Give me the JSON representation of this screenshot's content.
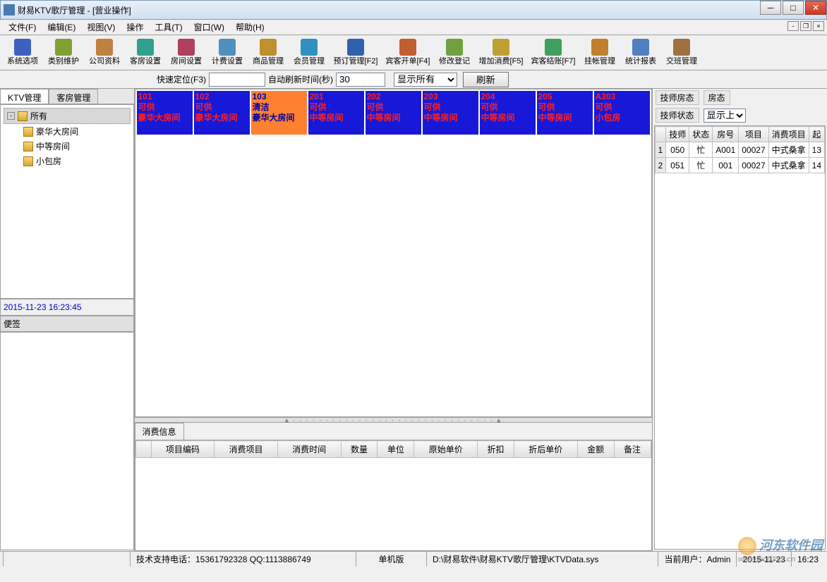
{
  "title": "财易KTV歌厅管理 - [营业操作]",
  "menus": [
    "文件(F)",
    "编辑(E)",
    "视图(V)",
    "操作",
    "工具(T)",
    "窗口(W)",
    "帮助(H)"
  ],
  "toolbar": [
    {
      "label": "系统选项",
      "c": "#4060c0"
    },
    {
      "label": "类别维护",
      "c": "#80a030"
    },
    {
      "label": "公司资料",
      "c": "#c08040"
    },
    {
      "label": "客房设置",
      "c": "#30a090"
    },
    {
      "label": "房间设置",
      "c": "#b04060"
    },
    {
      "label": "计费设置",
      "c": "#5090c0"
    },
    {
      "label": "商品管理",
      "c": "#c09030"
    },
    {
      "label": "会员管理",
      "c": "#3090c0"
    },
    {
      "label": "预订管理[F2]",
      "c": "#3060b0",
      "wide": true
    },
    {
      "label": "宾客开单[F4]",
      "c": "#c06030",
      "wide": true
    },
    {
      "label": "修改登记",
      "c": "#70a040"
    },
    {
      "label": "增加消费[F5]",
      "c": "#c0a030",
      "wide": true
    },
    {
      "label": "宾客结账[F7]",
      "c": "#40a060",
      "wide": true
    },
    {
      "label": "挂帐管理",
      "c": "#c08030"
    },
    {
      "label": "统计报表",
      "c": "#5080c0"
    },
    {
      "label": "交班管理",
      "c": "#a07040"
    }
  ],
  "filter": {
    "locate_label": "快速定位(F3)",
    "locate_val": "",
    "refresh_label": "自动刷新时间(秒)",
    "refresh_val": "30",
    "show_label": "显示所有",
    "show_val": "显示所有",
    "refresh_btn": "刷新"
  },
  "left_tabs": [
    "KTV管理",
    "客房管理"
  ],
  "tree": {
    "root": "所有",
    "children": [
      "豪华大房间",
      "中等房间",
      "小包房"
    ]
  },
  "timestamp": "2015-11-23 16:23:45",
  "notes_label": "便签",
  "rooms": [
    {
      "no": "101",
      "status": "可供",
      "type": "豪华大房间",
      "cls": "blue"
    },
    {
      "no": "102",
      "status": "可供",
      "type": "豪华大房间",
      "cls": "blue"
    },
    {
      "no": "103",
      "status": "清洁",
      "type": "豪华大房间",
      "cls": "orange"
    },
    {
      "no": "201",
      "status": "可供",
      "type": "中等房间",
      "cls": "blue"
    },
    {
      "no": "202",
      "status": "可供",
      "type": "中等房间",
      "cls": "blue"
    },
    {
      "no": "203",
      "status": "可供",
      "type": "中等房间",
      "cls": "blue"
    },
    {
      "no": "204",
      "status": "可供",
      "type": "中等房间",
      "cls": "blue"
    },
    {
      "no": "205",
      "status": "可供",
      "type": "中等房间",
      "cls": "blue"
    },
    {
      "no": "A303",
      "status": "可供",
      "type": "小包房",
      "cls": "blue"
    }
  ],
  "cons_tab": "消费信息",
  "cons_cols": [
    "项目编码",
    "消费项目",
    "消费时间",
    "数量",
    "单位",
    "原始单价",
    "折扣",
    "折后单价",
    "金额",
    "备注"
  ],
  "right": {
    "tech_room": "技师房态",
    "room_state": "房态",
    "tech_state": "技师状态",
    "show_sel": "显示上",
    "cols": [
      "技师",
      "状态",
      "房号",
      "项目",
      "消费项目",
      "起"
    ],
    "rows": [
      {
        "i": "1",
        "tech": "050",
        "st": "忙",
        "room": "A001",
        "proj": "00027",
        "item": "中式桑拿",
        "start": "13"
      },
      {
        "i": "2",
        "tech": "051",
        "st": "忙",
        "room": "001",
        "proj": "00027",
        "item": "中式桑拿",
        "start": "14"
      }
    ]
  },
  "status": {
    "empty": "",
    "support": "技术支持电话：15361792328 QQ:1113886749",
    "edition": "单机版",
    "path": "D:\\财易软件\\财易KTV歌厅管理\\KTVData.sys",
    "user_label": "当前用户：",
    "user": "Admin",
    "date": "2015-11-23",
    "time": "16:23"
  },
  "watermark": {
    "name": "河东软件园",
    "url": "www.pc0359.cn"
  }
}
